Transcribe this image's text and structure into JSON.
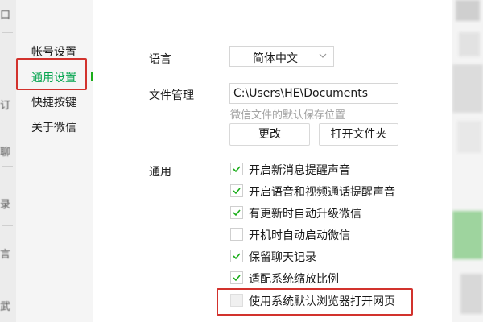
{
  "sidebar": {
    "items": [
      {
        "label": "帐号设置",
        "active": false
      },
      {
        "label": "通用设置",
        "active": true
      },
      {
        "label": "快捷按键",
        "active": false
      },
      {
        "label": "关于微信",
        "active": false
      }
    ]
  },
  "general": {
    "language_label": "语言",
    "language_value": "简体中文",
    "file_mgmt_label": "文件管理",
    "file_path": "C:\\Users\\HE\\Documents",
    "file_path_hint": "微信文件的默认保存位置",
    "change_button": "更改",
    "open_folder_button": "打开文件夹",
    "general_label": "通用",
    "options": [
      {
        "label": "开启新消息提醒声音",
        "checked": true
      },
      {
        "label": "开启语音和视频通话提醒声音",
        "checked": true
      },
      {
        "label": "有更新时自动升级微信",
        "checked": true
      },
      {
        "label": "开机时自动启动微信",
        "checked": false
      },
      {
        "label": "保留聊天记录",
        "checked": true
      },
      {
        "label": "适配系统缩放比例",
        "checked": true
      },
      {
        "label": "使用系统默认浏览器打开网页",
        "checked": false
      }
    ]
  },
  "background": {
    "left_chars": [
      "订",
      "聊",
      "录",
      "言",
      "武",
      "口"
    ]
  },
  "colors": {
    "accent": "#07a550",
    "check": "#1aad19",
    "highlight": "#d2322d"
  },
  "icons": {
    "check": "check-icon",
    "dropdown": "chevron-down-icon"
  }
}
